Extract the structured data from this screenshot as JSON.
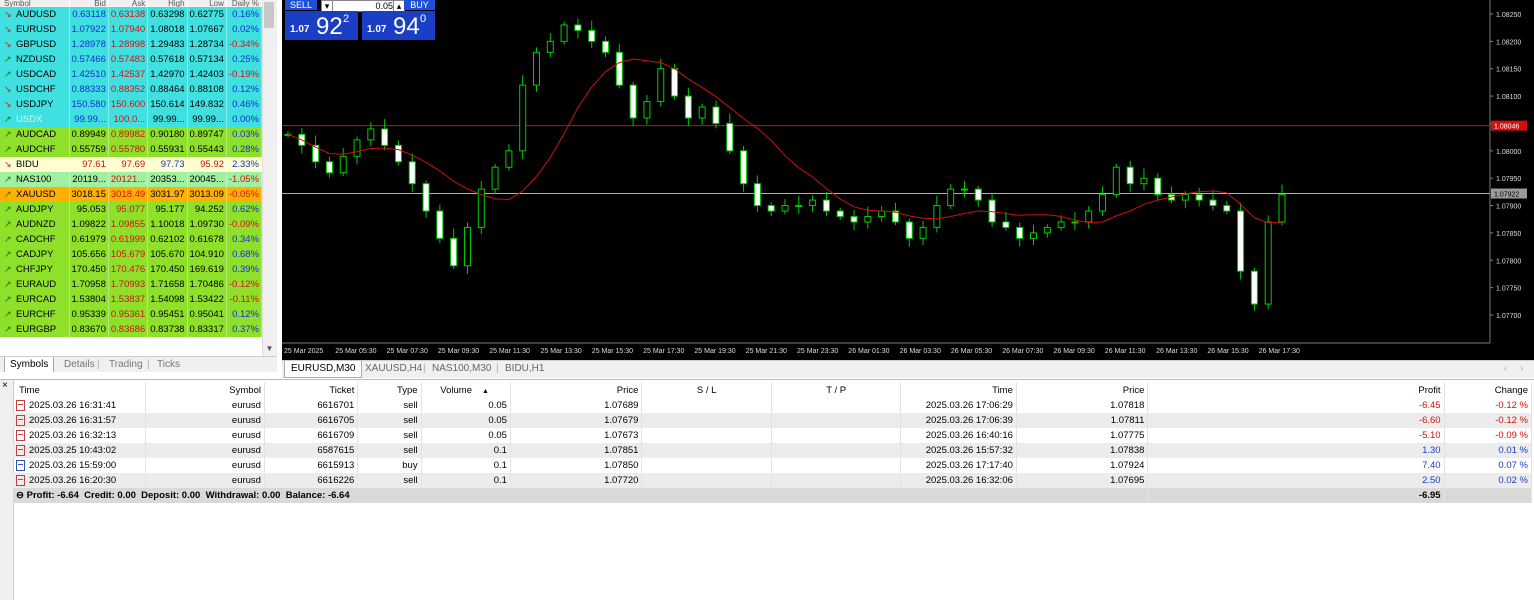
{
  "market_watch": {
    "header": [
      "Symbol",
      "Bid",
      "Ask",
      "High",
      "Low",
      "Daily %"
    ],
    "rows": [
      {
        "dir": "down",
        "symbol": "AUDUSD",
        "bid": "0.63118",
        "ask": "0.63138",
        "high": "0.63298",
        "low": "0.62775",
        "daily": "0.16%",
        "bg": "#40e0e0"
      },
      {
        "dir": "down",
        "symbol": "EURUSD",
        "bid": "1.07922",
        "ask": "1.07940",
        "high": "1.08018",
        "low": "1.07667",
        "daily": "0.02%",
        "bg": "#40e0e0"
      },
      {
        "dir": "down",
        "symbol": "GBPUSD",
        "bid": "1.28978",
        "ask": "1.28998",
        "high": "1.29483",
        "low": "1.28734",
        "daily": "-0.34%",
        "bg": "#40e0e0"
      },
      {
        "dir": "up",
        "symbol": "NZDUSD",
        "bid": "0.57466",
        "ask": "0.57483",
        "high": "0.57618",
        "low": "0.57134",
        "daily": "0.25%",
        "bg": "#40e0e0"
      },
      {
        "dir": "up",
        "symbol": "USDCAD",
        "bid": "1.42510",
        "ask": "1.42537",
        "high": "1.42970",
        "low": "1.42403",
        "daily": "-0.19%",
        "bg": "#40e0e0"
      },
      {
        "dir": "down",
        "symbol": "USDCHF",
        "bid": "0.88333",
        "ask": "0.88352",
        "high": "0.88464",
        "low": "0.88108",
        "daily": "0.12%",
        "bg": "#40e0e0"
      },
      {
        "dir": "down",
        "symbol": "USDJPY",
        "bid": "150.580",
        "ask": "150.600",
        "high": "150.614",
        "low": "149.832",
        "daily": "0.46%",
        "bg": "#40e0e0"
      },
      {
        "dir": "up",
        "symbol": "USDX",
        "bid": "99.99...",
        "ask": "100.0...",
        "high": "99.99...",
        "low": "99.99...",
        "daily": "0.00%",
        "bg": "#40e0e0",
        "dim": true
      },
      {
        "dir": "up",
        "symbol": "AUDCAD",
        "bid": "0.89949",
        "ask": "0.89982",
        "high": "0.90180",
        "low": "0.89747",
        "daily": "0.03%",
        "bg": "#8ee02a"
      },
      {
        "dir": "up",
        "symbol": "AUDCHF",
        "bid": "0.55759",
        "ask": "0.55780",
        "high": "0.55931",
        "low": "0.55443",
        "daily": "0.28%",
        "bg": "#8ee02a"
      },
      {
        "dir": "down",
        "symbol": "BIDU",
        "bid": "97.61",
        "ask": "97.69",
        "high": "97.73",
        "low": "95.92",
        "daily": "2.33%",
        "bg": "#ffffd0"
      },
      {
        "dir": "up",
        "symbol": "NAS100",
        "bid": "20119...",
        "ask": "20121...",
        "high": "20353...",
        "low": "20045...",
        "daily": "-1.05%",
        "bg": "#a0f0a0"
      },
      {
        "dir": "up",
        "symbol": "XAUUSD",
        "bid": "3018.15",
        "ask": "3018.49",
        "high": "3031.97",
        "low": "3013.09",
        "daily": "-0.05%",
        "bg": "#ffb000"
      },
      {
        "dir": "up",
        "symbol": "AUDJPY",
        "bid": "95.053",
        "ask": "95.077",
        "high": "95.177",
        "low": "94.252",
        "daily": "0.62%",
        "bg": "#8ee02a"
      },
      {
        "dir": "up",
        "symbol": "AUDNZD",
        "bid": "1.09822",
        "ask": "1.09855",
        "high": "1.10018",
        "low": "1.09730",
        "daily": "-0.09%",
        "bg": "#8ee02a"
      },
      {
        "dir": "up",
        "symbol": "CADCHF",
        "bid": "0.61979",
        "ask": "0.61999",
        "high": "0.62102",
        "low": "0.61678",
        "daily": "0.34%",
        "bg": "#8ee02a"
      },
      {
        "dir": "up",
        "symbol": "CADJPY",
        "bid": "105.656",
        "ask": "105.679",
        "high": "105.670",
        "low": "104.910",
        "daily": "0.68%",
        "bg": "#8ee02a"
      },
      {
        "dir": "up",
        "symbol": "CHFJPY",
        "bid": "170.450",
        "ask": "170.476",
        "high": "170.450",
        "low": "169.619",
        "daily": "0.39%",
        "bg": "#8ee02a"
      },
      {
        "dir": "up",
        "symbol": "EURAUD",
        "bid": "1.70958",
        "ask": "1.70993",
        "high": "1.71658",
        "low": "1.70486",
        "daily": "-0.12%",
        "bg": "#8ee02a"
      },
      {
        "dir": "up",
        "symbol": "EURCAD",
        "bid": "1.53804",
        "ask": "1.53837",
        "high": "1.54098",
        "low": "1.53422",
        "daily": "-0.11%",
        "bg": "#8ee02a"
      },
      {
        "dir": "up",
        "symbol": "EURCHF",
        "bid": "0.95339",
        "ask": "0.95361",
        "high": "0.95451",
        "low": "0.95041",
        "daily": "0.12%",
        "bg": "#8ee02a"
      },
      {
        "dir": "up",
        "symbol": "EURGBP",
        "bid": "0.83670",
        "ask": "0.83686",
        "high": "0.83738",
        "low": "0.83317",
        "daily": "0.37%",
        "bg": "#8ee02a"
      }
    ],
    "tabs": [
      "Symbols",
      "Details",
      "Trading",
      "Ticks"
    ]
  },
  "one_click": {
    "sell": "SELL",
    "buy": "BUY",
    "lot": "0.05",
    "sell_prefix": "1.07",
    "sell_big": "92",
    "sell_pip": "2",
    "buy_prefix": "1.07",
    "buy_big": "94",
    "buy_pip": "0"
  },
  "chart": {
    "symbol": "EURUSD",
    "timeframe": "M30",
    "price_labels": [
      "1.08250",
      "1.08200",
      "1.08150",
      "1.08100",
      "1.08050",
      "1.08000",
      "1.07950",
      "1.07900",
      "1.07850",
      "1.07800",
      "1.07750",
      "1.07700"
    ],
    "highlight_red": "1.08046",
    "highlight_gray": "1.07922",
    "time_labels": [
      "25 Mar 2025",
      "25 Mar 05:30",
      "25 Mar 07:30",
      "25 Mar 09:30",
      "25 Mar 11:30",
      "25 Mar 13:30",
      "25 Mar 15:30",
      "25 Mar 17:30",
      "25 Mar 19:30",
      "25 Mar 21:30",
      "25 Mar 23:30",
      "26 Mar 01:30",
      "26 Mar 03:30",
      "26 Mar 05:30",
      "26 Mar 07:30",
      "26 Mar 09:30",
      "26 Mar 11:30",
      "26 Mar 13:30",
      "26 Mar 15:30",
      "26 Mar 17:30"
    ],
    "colors": {
      "bg": "#000000",
      "bull": "#ffffff",
      "bear": "#ffffff",
      "wick": "#00cc00",
      "ma": "#cc1010",
      "hline_red": "#cc1010",
      "hline_gray": "#b0b0b0"
    }
  },
  "chart_tabs": [
    "EURUSD,M30",
    "XAUUSD,H4",
    "NAS100,M30",
    "BIDU,H1"
  ],
  "terminal": {
    "columns": [
      "Time",
      "Symbol",
      "Ticket",
      "Type",
      "Volume",
      "Price",
      "S / L",
      "T / P",
      "Time",
      "Price",
      "Profit",
      "Change"
    ],
    "sort_indicator": "▲",
    "rows": [
      {
        "type_icon": "sell",
        "time": "2025.03.26 16:31:41",
        "symbol": "eurusd",
        "ticket": "6616701",
        "type": "sell",
        "volume": "0.05",
        "price": "1.07689",
        "sl": "",
        "tp": "",
        "close_time": "2025.03.26 17:06:29",
        "close_price": "1.07818",
        "profit": "-6.45",
        "change": "-0.12 %",
        "sign": "neg"
      },
      {
        "type_icon": "sell",
        "time": "2025.03.26 16:31:57",
        "symbol": "eurusd",
        "ticket": "6616705",
        "type": "sell",
        "volume": "0.05",
        "price": "1.07679",
        "sl": "",
        "tp": "",
        "close_time": "2025.03.26 17:06:39",
        "close_price": "1.07811",
        "profit": "-6.60",
        "change": "-0.12 %",
        "sign": "neg"
      },
      {
        "type_icon": "sell",
        "time": "2025.03.26 16:32:13",
        "symbol": "eurusd",
        "ticket": "6616709",
        "type": "sell",
        "volume": "0.05",
        "price": "1.07673",
        "sl": "",
        "tp": "",
        "close_time": "2025.03.26 16:40:16",
        "close_price": "1.07775",
        "profit": "-5.10",
        "change": "-0.09 %",
        "sign": "neg"
      },
      {
        "type_icon": "sell",
        "time": "2025.03.25 10:43:02",
        "symbol": "eurusd",
        "ticket": "6587615",
        "type": "sell",
        "volume": "0.1",
        "price": "1.07851",
        "sl": "",
        "tp": "",
        "close_time": "2025.03.26 15:57:32",
        "close_price": "1.07838",
        "profit": "1.30",
        "change": "0.01 %",
        "sign": "pos"
      },
      {
        "type_icon": "buy",
        "time": "2025.03.26 15:59:00",
        "symbol": "eurusd",
        "ticket": "6615913",
        "type": "buy",
        "volume": "0.1",
        "price": "1.07850",
        "sl": "",
        "tp": "",
        "close_time": "2025.03.26 17:17:40",
        "close_price": "1.07924",
        "profit": "7.40",
        "change": "0.07 %",
        "sign": "pos"
      },
      {
        "type_icon": "sell",
        "time": "2025.03.26 16:20:30",
        "symbol": "eurusd",
        "ticket": "6616226",
        "type": "sell",
        "volume": "0.1",
        "price": "1.07720",
        "sl": "",
        "tp": "",
        "close_time": "2025.03.26 16:32:06",
        "close_price": "1.07695",
        "profit": "2.50",
        "change": "0.02 %",
        "sign": "pos"
      }
    ],
    "summary": "Profit: -6.64  Credit: 0.00  Deposit: 0.00  Withdrawal: 0.00  Balance: -6.64",
    "summary_total": "-6.95"
  }
}
